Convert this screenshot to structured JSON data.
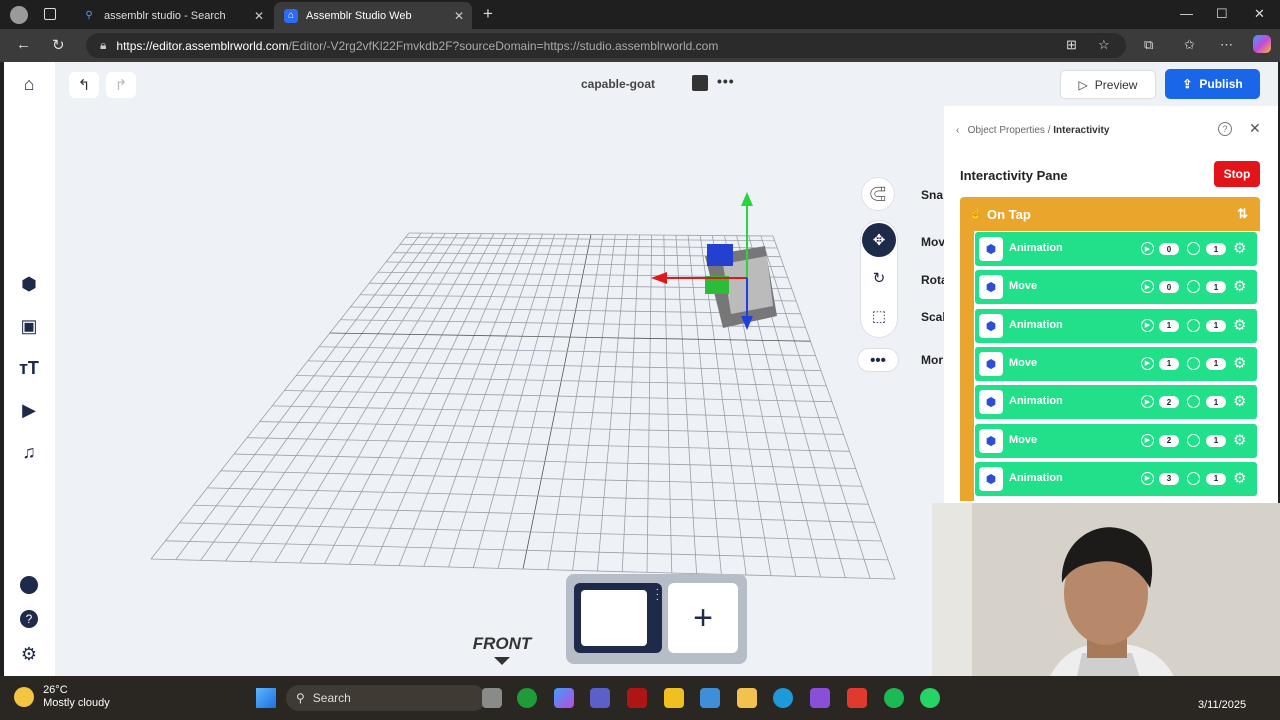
{
  "browser": {
    "tabs": [
      {
        "label": "assemblr studio - Search"
      },
      {
        "label": "Assemblr Studio Web"
      }
    ],
    "url_host": "https://editor.assemblrworld.com",
    "url_path": "/Editor/-V2rg2vfKl22Fmvkdb2F?sourceDomain=https://studio.assemblrworld.com"
  },
  "editor": {
    "project_name": "capable-goat",
    "preview_label": "Preview",
    "publish_label": "Publish",
    "side_tools": {
      "snap": "Sna",
      "move": "Mov",
      "rotate": "Rota",
      "scale": "Scal",
      "more": "Mor"
    },
    "view_label": "FRONT"
  },
  "pane": {
    "breadcrumb_parent": "Object Properties",
    "breadcrumb_current": "Interactivity",
    "title": "Interactivity Pane",
    "stop_label": "Stop",
    "trigger_label": "On Tap",
    "actions": [
      {
        "label": "Animation",
        "order": "0",
        "count": "1"
      },
      {
        "label": "Move",
        "order": "0",
        "count": "1"
      },
      {
        "label": "Animation",
        "order": "1",
        "count": "1"
      },
      {
        "label": "Move",
        "order": "1",
        "count": "1"
      },
      {
        "label": "Animation",
        "order": "2",
        "count": "1"
      },
      {
        "label": "Move",
        "order": "2",
        "count": "1"
      },
      {
        "label": "Animation",
        "order": "3",
        "count": "1"
      }
    ]
  },
  "taskbar": {
    "temperature": "26°C",
    "weather": "Mostly cloudy",
    "search_label": "Search",
    "date": "3/11/2025"
  },
  "colors": {
    "accent_blue": "#1a66e8",
    "stop_red": "#e2141a",
    "trigger_orange": "#eaa62c",
    "action_green": "#22e08a"
  }
}
